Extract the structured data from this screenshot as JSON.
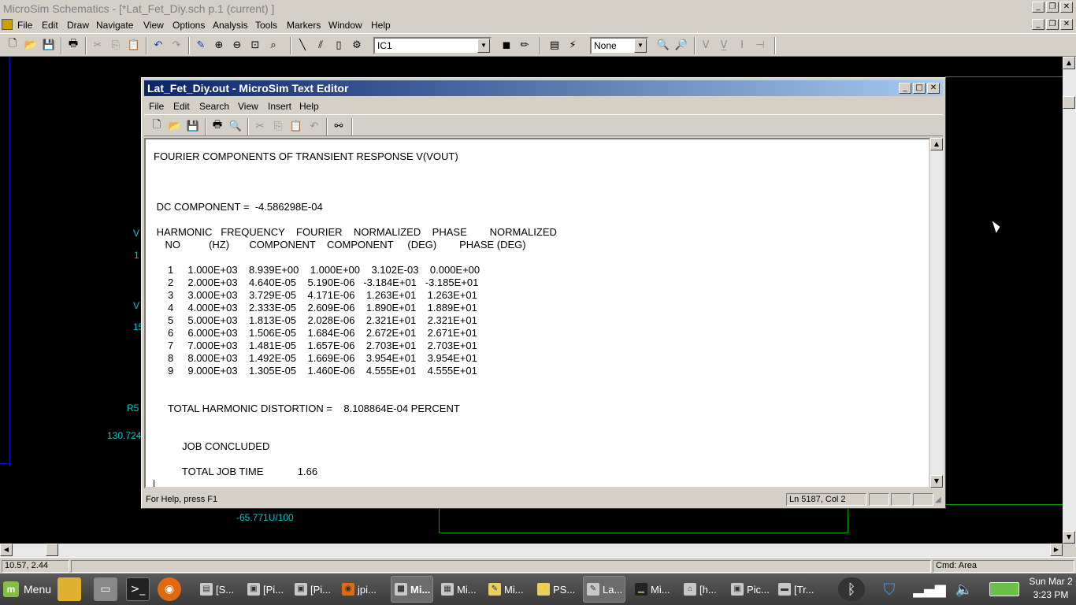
{
  "main_window": {
    "title": "MicroSim Schematics - [*Lat_Fet_Diy.sch  p.1 (current)  ]",
    "menu": [
      "File",
      "Edit",
      "Draw",
      "Navigate",
      "View",
      "Options",
      "Analysis",
      "Tools",
      "Markers",
      "Window",
      "Help"
    ],
    "part_combo_value": "IC1",
    "zoom_combo_value": "None"
  },
  "canvas": {
    "labels": [
      "V",
      "1",
      "V",
      "15",
      "R5",
      "130.724",
      "-65.771U/100"
    ]
  },
  "status": {
    "coords": "10.57,  2.44",
    "cmd": "Cmd: Area"
  },
  "editor": {
    "title": "Lat_Fet_Diy.out - MicroSim Text Editor",
    "menu": [
      "File",
      "Edit",
      "Search",
      "View",
      "Insert",
      "Help"
    ],
    "lines": [
      "FOURIER COMPONENTS OF TRANSIENT RESPONSE V(VOUT)",
      " DC COMPONENT =  -4.586298E-04",
      " HARMONIC   FREQUENCY    FOURIER    NORMALIZED    PHASE        NORMALIZED",
      "    NO          (HZ)       COMPONENT    COMPONENT     (DEG)        PHASE (DEG)",
      "     1     1.000E+03    8.939E+00    1.000E+00    3.102E-03    0.000E+00",
      "     2     2.000E+03    4.640E-05    5.190E-06   -3.184E+01   -3.185E+01",
      "     3     3.000E+03    3.729E-05    4.171E-06    1.263E+01    1.263E+01",
      "     4     4.000E+03    2.333E-05    2.609E-06    1.890E+01    1.889E+01",
      "     5     5.000E+03    1.813E-05    2.028E-06    2.321E+01    2.321E+01",
      "     6     6.000E+03    1.506E-05    1.684E-06    2.672E+01    2.671E+01",
      "     7     7.000E+03    1.481E-05    1.657E-06    2.703E+01    2.703E+01",
      "     8     8.000E+03    1.492E-05    1.669E-06    3.954E+01    3.954E+01",
      "     9     9.000E+03    1.305E-05    1.460E-06    4.555E+01    4.555E+01",
      "     TOTAL HARMONIC DISTORTION =    8.108864E-04 PERCENT",
      "          JOB CONCLUDED",
      "          TOTAL JOB TIME            1.66"
    ],
    "status_msg": "For Help, press F1",
    "status_pos": "Ln 5187, Col 2"
  },
  "taskbar": {
    "menu_label": "Menu",
    "tasks": [
      "[S...",
      "[Pi...",
      "[Pi...",
      "jpi...",
      "Mi...",
      "Mi...",
      "Mi...",
      "PS...",
      "La...",
      "Mi...",
      "[h...",
      "Pic...",
      "[Tr..."
    ],
    "clock_day": "Sun Mar 2",
    "clock_time": "3:23 PM"
  }
}
